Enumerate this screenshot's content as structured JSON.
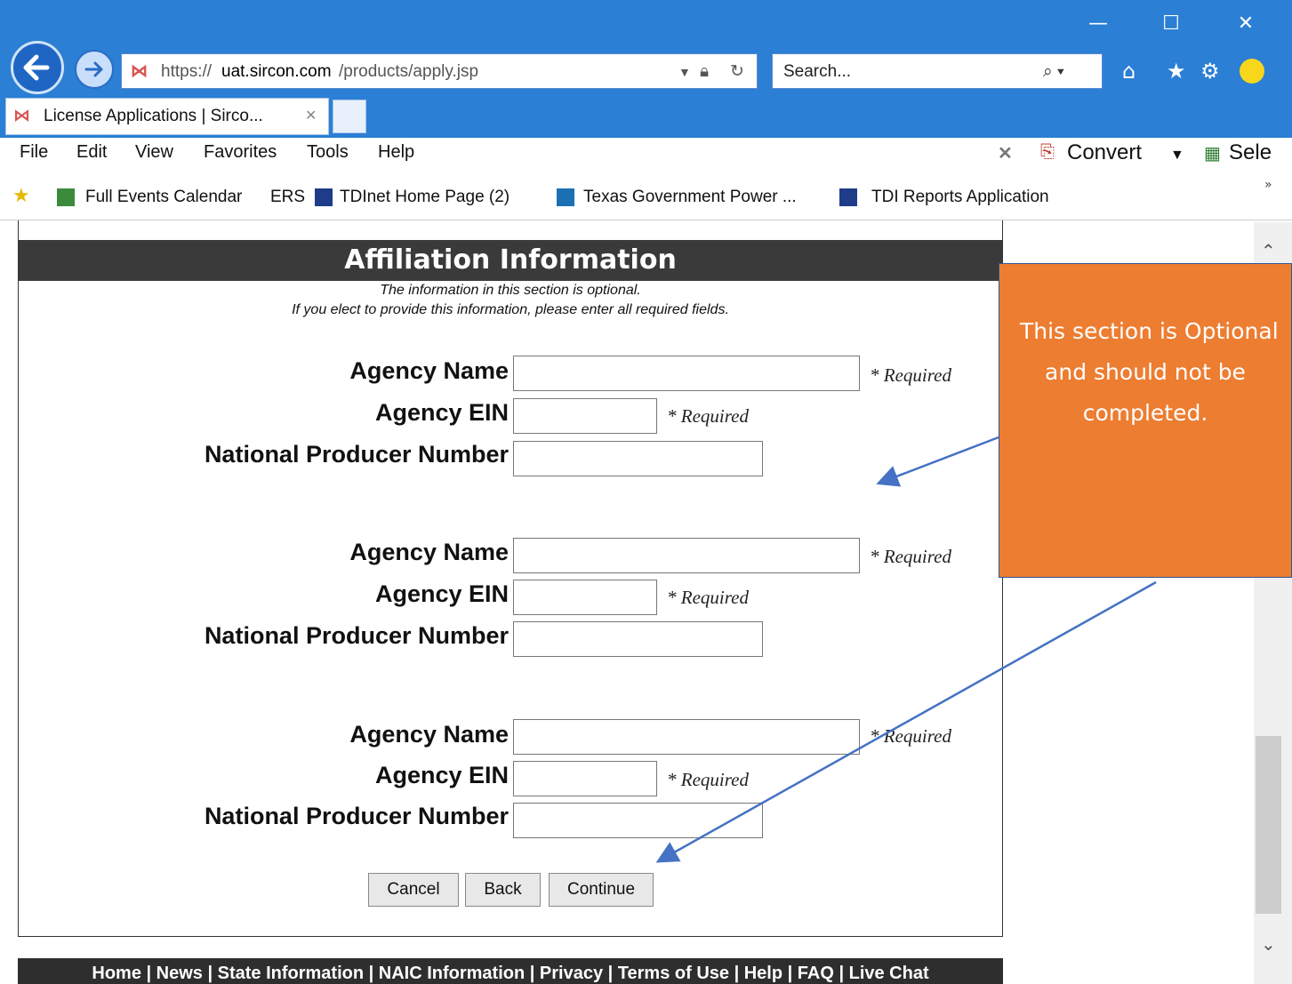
{
  "browser": {
    "url_prefix": "https://",
    "url_host": "uat.sircon.com",
    "url_path": "/products/apply.jsp",
    "search_placeholder": "Search...",
    "tab_title": "License Applications | Sirco...",
    "window_controls": {
      "minimize": "—",
      "maximize": "☐",
      "close": "✕"
    }
  },
  "menu": [
    "File",
    "Edit",
    "View",
    "Favorites",
    "Tools",
    "Help"
  ],
  "toolbar": {
    "convert_label": "Convert",
    "select_label": "Sele"
  },
  "favorites": [
    "Full Events Calendar",
    "ERS",
    "TDInet Home Page (2)",
    "Texas Government Power ...",
    "TDI Reports Application"
  ],
  "page": {
    "section_title": "Affiliation Information",
    "note_line1": "The information in this section is optional.",
    "note_line2": "If you elect to provide this information, please enter all required fields.",
    "field_labels": {
      "agency_name": "Agency Name",
      "agency_ein": "Agency EIN",
      "npn": "National Producer Number"
    },
    "required_text": "* Required",
    "groups": [
      {
        "agency_name": "",
        "agency_ein": "",
        "npn": ""
      },
      {
        "agency_name": "",
        "agency_ein": "",
        "npn": ""
      },
      {
        "agency_name": "",
        "agency_ein": "",
        "npn": ""
      }
    ],
    "buttons": {
      "cancel": "Cancel",
      "back": "Back",
      "continue": "Continue"
    },
    "footer": "Home | News | State Information | NAIC Information | Privacy | Terms of Use | Help | FAQ | Live Chat"
  },
  "callout": {
    "line1": "This section is Optional",
    "line2": "and should not be",
    "line3": "completed.",
    "fill_color": "#ed7d31"
  }
}
